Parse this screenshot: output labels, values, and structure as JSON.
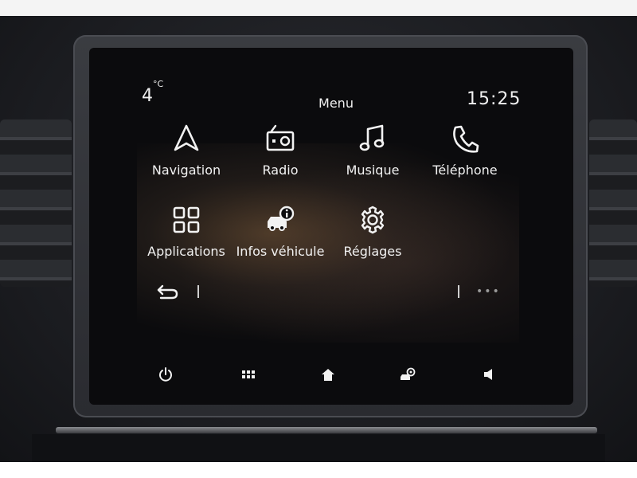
{
  "status": {
    "temperature": "4",
    "temperature_unit": "°C",
    "title": "Menu",
    "clock": "15:25"
  },
  "menu": {
    "items": [
      {
        "label": "Navigation",
        "icon": "navigation-arrow-icon"
      },
      {
        "label": "Radio",
        "icon": "radio-icon"
      },
      {
        "label": "Musique",
        "icon": "music-note-icon"
      },
      {
        "label": "Téléphone",
        "icon": "phone-icon"
      },
      {
        "label": "Applications",
        "icon": "apps-grid-icon"
      },
      {
        "label": "Infos véhicule",
        "icon": "vehicle-info-icon"
      },
      {
        "label": "Réglages",
        "icon": "gear-icon"
      }
    ]
  },
  "nav": {
    "back_icon": "back-arrow-icon",
    "more_label": "•••"
  },
  "bottom_bar": {
    "buttons": [
      {
        "icon": "power-icon"
      },
      {
        "icon": "apps-icon"
      },
      {
        "icon": "home-icon"
      },
      {
        "icon": "car-settings-icon"
      },
      {
        "icon": "volume-icon"
      }
    ]
  },
  "colors": {
    "text": "#f2f2f2",
    "screen_background": "#0b0b0d",
    "bezel": "#2a2b30"
  }
}
